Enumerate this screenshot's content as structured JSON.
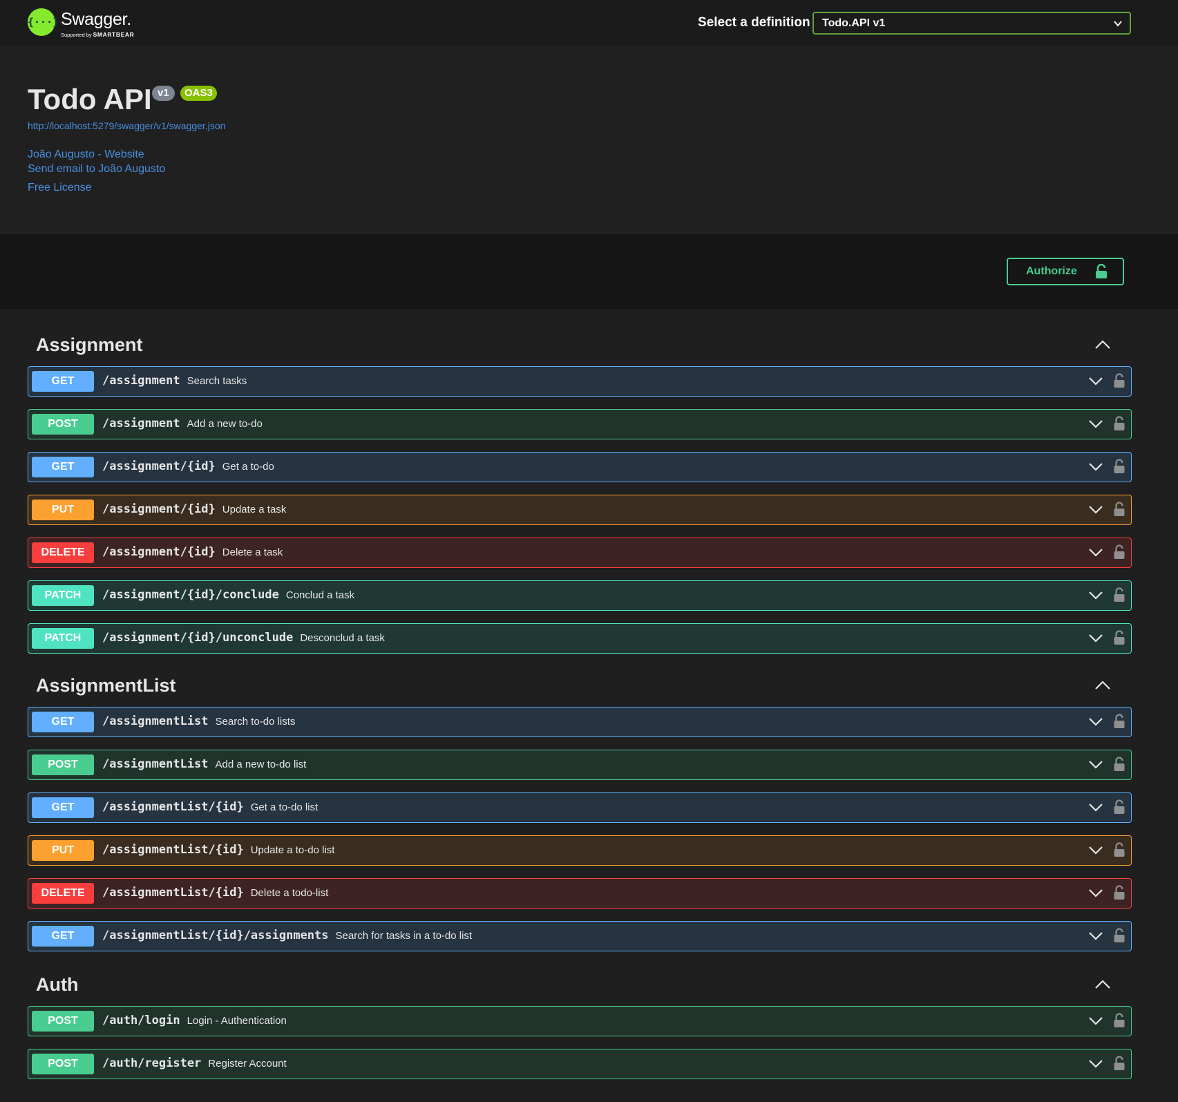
{
  "topbar": {
    "logo_glyph": "{···}",
    "logo_name": "Swagger.",
    "logo_supported": "Supported by",
    "logo_company": "SMARTBEAR",
    "definition_label": "Select a definition",
    "definition_value": "Todo.API v1"
  },
  "info": {
    "title": "Todo API",
    "version": "v1",
    "oas": "OAS3",
    "spec_url": "http://localhost:5279/swagger/v1/swagger.json",
    "website": "João Augusto - Website",
    "email": "Send email to João Augusto",
    "license": "Free License"
  },
  "scheme": {
    "authorize_label": "Authorize"
  },
  "colors": {
    "get": "#61affe",
    "post": "#49cc90",
    "put": "#fca130",
    "delete": "#f93e3e",
    "patch": "#50e3c2",
    "link": "#4990e2",
    "brand": "#85ea2d"
  },
  "icons": {
    "collapse": "chevron-up-icon",
    "expand": "chevron-down-icon",
    "lock": "lock-icon",
    "authorize_lock": "lock-icon"
  },
  "tags": [
    {
      "name": "Assignment",
      "operations": [
        {
          "method": "GET",
          "path": "/assignment",
          "summary": "Search tasks"
        },
        {
          "method": "POST",
          "path": "/assignment",
          "summary": "Add a new to-do"
        },
        {
          "method": "GET",
          "path": "/assignment/{id}",
          "summary": "Get a to-do"
        },
        {
          "method": "PUT",
          "path": "/assignment/{id}",
          "summary": "Update a task"
        },
        {
          "method": "DELETE",
          "path": "/assignment/{id}",
          "summary": "Delete a task"
        },
        {
          "method": "PATCH",
          "path": "/assignment/{id}/conclude",
          "summary": "Conclud a task"
        },
        {
          "method": "PATCH",
          "path": "/assignment/{id}/unconclude",
          "summary": "Desconclud a task"
        }
      ]
    },
    {
      "name": "AssignmentList",
      "operations": [
        {
          "method": "GET",
          "path": "/assignmentList",
          "summary": "Search to-do lists"
        },
        {
          "method": "POST",
          "path": "/assignmentList",
          "summary": "Add a new to-do list"
        },
        {
          "method": "GET",
          "path": "/assignmentList/{id}",
          "summary": "Get a to-do list"
        },
        {
          "method": "PUT",
          "path": "/assignmentList/{id}",
          "summary": "Update a to-do list"
        },
        {
          "method": "DELETE",
          "path": "/assignmentList/{id}",
          "summary": "Delete a todo-list"
        },
        {
          "method": "GET",
          "path": "/assignmentList/{id}/assignments",
          "summary": "Search for tasks in a to-do list"
        }
      ]
    },
    {
      "name": "Auth",
      "operations": [
        {
          "method": "POST",
          "path": "/auth/login",
          "summary": "Login - Authentication"
        },
        {
          "method": "POST",
          "path": "/auth/register",
          "summary": "Register Account"
        }
      ]
    }
  ]
}
